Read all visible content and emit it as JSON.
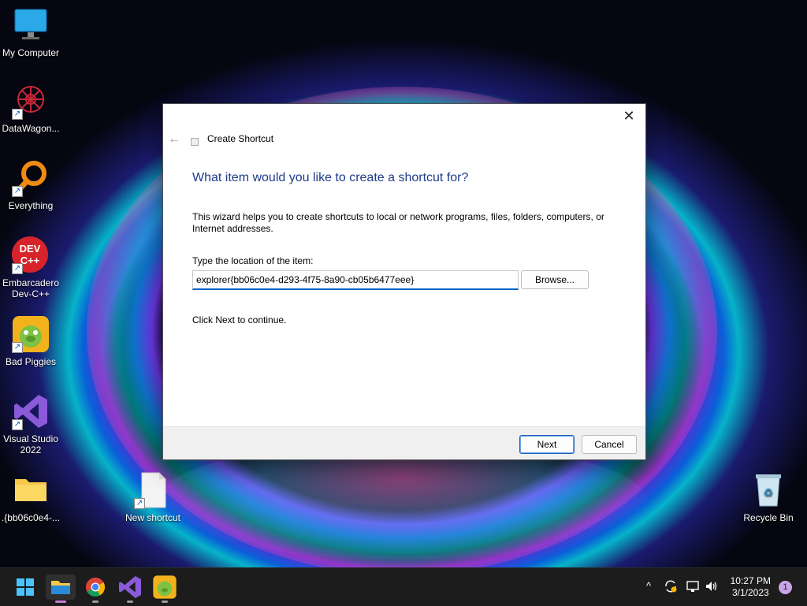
{
  "desktop": {
    "icons": [
      {
        "label": "My Computer"
      },
      {
        "label": "DataWagon..."
      },
      {
        "label": "Everything"
      },
      {
        "label": "Embarcadero Dev-C++"
      },
      {
        "label": "Bad Piggies"
      },
      {
        "label": "Visual Studio 2022"
      },
      {
        "label": ".{bb06c0e4-..."
      },
      {
        "label": "New shortcut"
      },
      {
        "label": "Recycle Bin"
      }
    ],
    "devcpp_icon_text": "DEV C++"
  },
  "dialog": {
    "title": "Create Shortcut",
    "heading": "What item would you like to create a shortcut for?",
    "description": "This wizard helps you to create shortcuts to local or network programs, files, folders, computers, or Internet addresses.",
    "location_label": "Type the location of the item:",
    "location_value": "explorer{bb06c0e4-d293-4f75-8a90-cb05b6477eee}",
    "browse_label": "Browse...",
    "hint": "Click Next to continue.",
    "next_label": "Next",
    "cancel_label": "Cancel",
    "close_glyph": "✕",
    "back_glyph": "←"
  },
  "taskbar": {
    "time": "10:27 PM",
    "date": "3/1/2023",
    "notification_count": "1",
    "tray_chevron": "^"
  },
  "colors": {
    "heading": "#1f3b8a",
    "accent": "#0a63c8",
    "taskbar": "#1c1c1c"
  }
}
